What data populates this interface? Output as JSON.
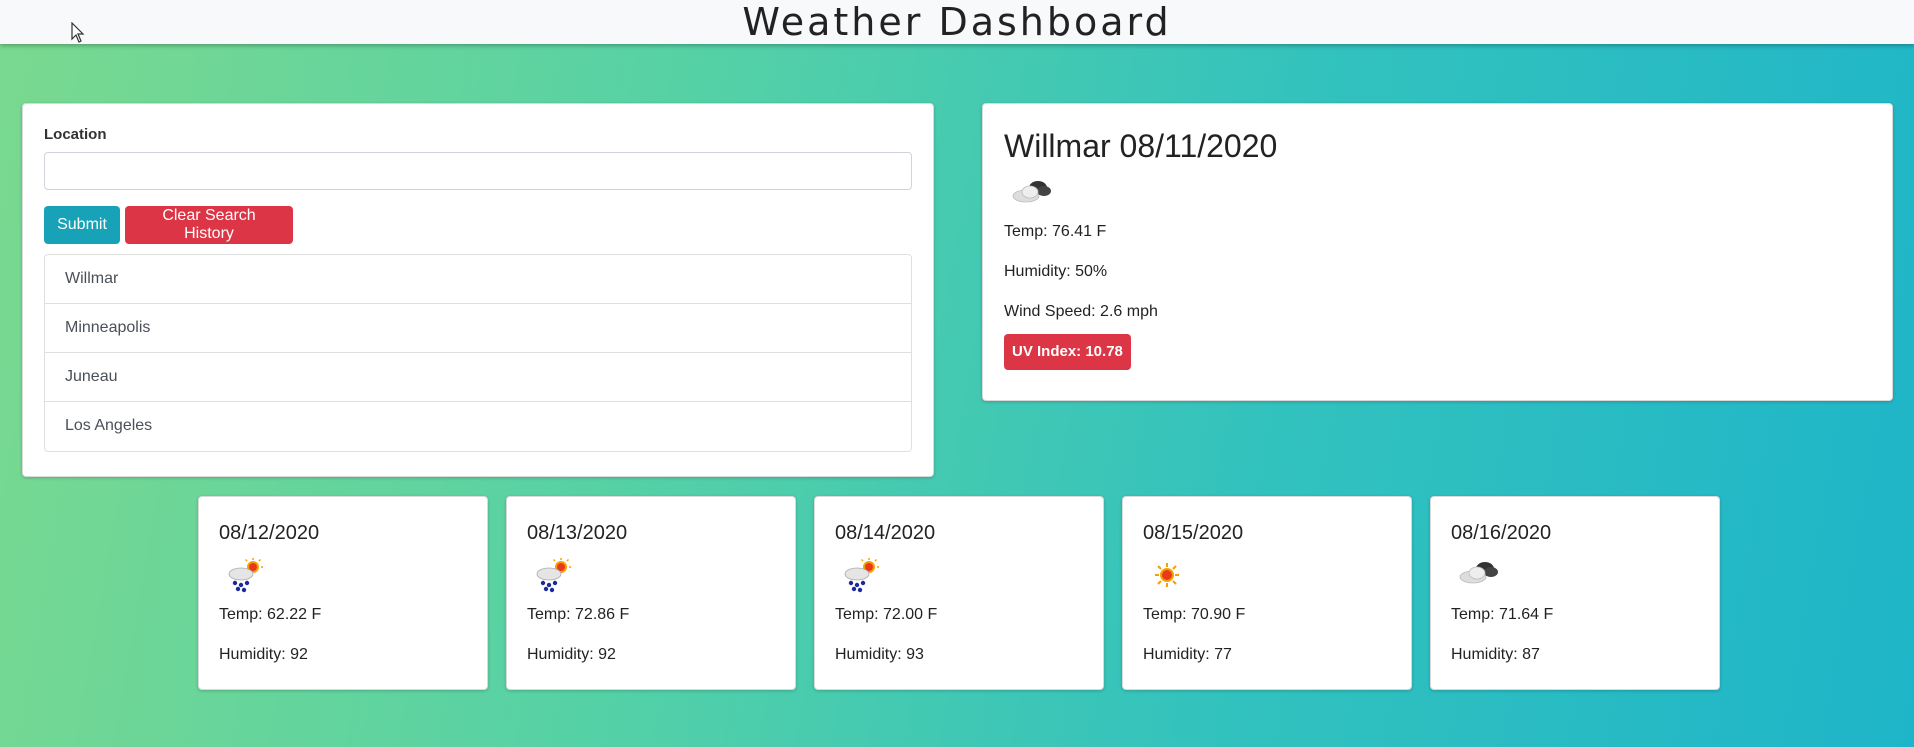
{
  "header": {
    "title": "Weather Dashboard"
  },
  "search": {
    "label": "Location",
    "input_value": "",
    "placeholder": "",
    "submit_label": "Submit",
    "clear_label": "Clear Search History",
    "history": [
      "Willmar",
      "Minneapolis",
      "Juneau",
      "Los Angeles"
    ]
  },
  "current": {
    "title": "Willmar 08/11/2020",
    "icon": "cloudy-icon",
    "temp": "Temp: 76.41 F",
    "humidity": "Humidity: 50%",
    "wind": "Wind Speed: 2.6 mph",
    "uv": "UV Index: 10.78"
  },
  "forecast": [
    {
      "date": "08/12/2020",
      "icon": "rain-sun-icon",
      "temp": "Temp: 62.22 F",
      "humidity": "Humidity: 92"
    },
    {
      "date": "08/13/2020",
      "icon": "rain-sun-icon",
      "temp": "Temp: 72.86 F",
      "humidity": "Humidity: 92"
    },
    {
      "date": "08/14/2020",
      "icon": "rain-sun-icon",
      "temp": "Temp: 72.00 F",
      "humidity": "Humidity: 93"
    },
    {
      "date": "08/15/2020",
      "icon": "sun-icon",
      "temp": "Temp: 70.90 F",
      "humidity": "Humidity: 77"
    },
    {
      "date": "08/16/2020",
      "icon": "cloudy-icon",
      "temp": "Temp: 71.64 F",
      "humidity": "Humidity: 87"
    }
  ],
  "colors": {
    "submit": "#17a2b8",
    "danger": "#dc3545",
    "background_start": "#7ad98f",
    "background_end": "#1eb5c9"
  }
}
